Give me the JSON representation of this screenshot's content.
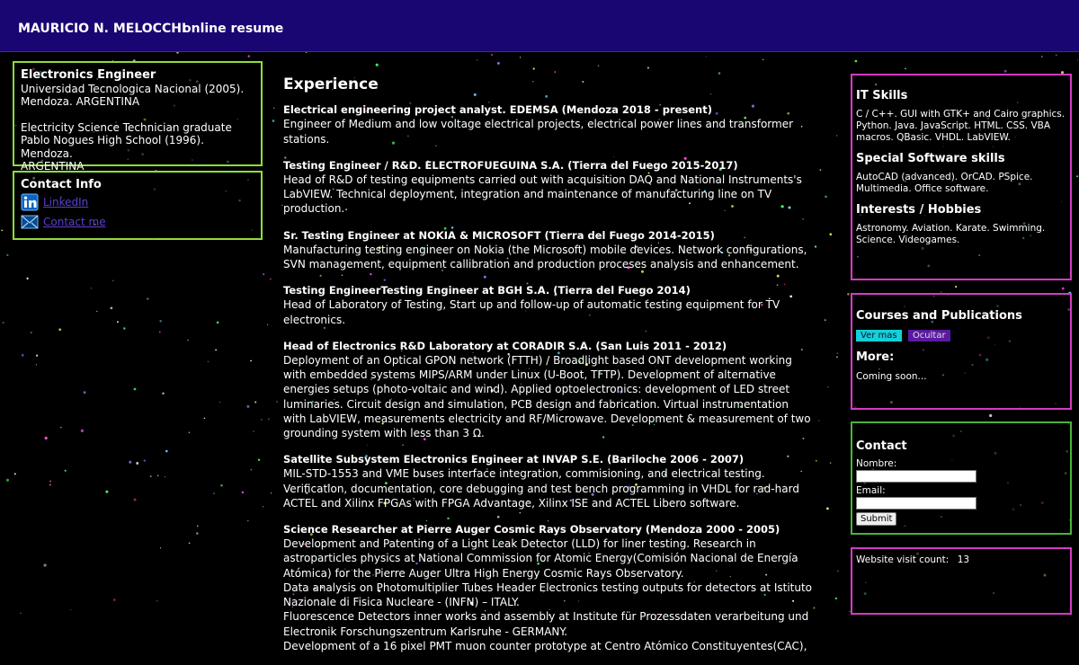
{
  "header": {
    "name": "MAURICIO N. MELOCCHI",
    "subtitle": "online resume"
  },
  "education": {
    "title": "Electronics Engineer",
    "line1": "Universidad Tecnologica Nacional (2005).",
    "line2": "Mendoza. ARGENTINA",
    "line3": "Electricity Science Technician graduate",
    "line4": "Pablo Nogues High School (1996). Mendoza.",
    "line5": "ARGENTINA"
  },
  "contact_info": {
    "title": "Contact Info",
    "linkedin_label": "LinkedIn",
    "mail_label": "Contact me",
    "icons": [
      "linkedin-icon",
      "mail-icon"
    ]
  },
  "experience": {
    "heading": "Experience",
    "jobs": [
      {
        "title": "Electrical engineering project analyst. EDEMSA (Mendoza 2018 - present)",
        "desc": "Engineer of Medium and low voltage electrical projects, electrical power lines and transformer stations."
      },
      {
        "title": "Testing Engineer / R&D. ELECTROFUEGUINA S.A. (Tierra del Fuego 2015-2017)",
        "desc": "Head of R&D of testing equipments carried out with acquisition DAQ and National Instruments's LabVIEW. Technical deployment, integration and maintenance of manufacturing line on TV production."
      },
      {
        "title": "Sr. Testing Engineer at NOKIA & MICROSOFT (Tierra del Fuego 2014-2015)",
        "desc": "Manufacturing testing engineer on Nokia (the Microsoft) mobile devices. Network configurations, SVN management, equipment callibration and production proceses analysis and enhancement."
      },
      {
        "title": "Testing EngineerTesting Engineer at BGH S.A. (Tierra del Fuego 2014)",
        "desc": "Head of Laboratory of Testing, Start up and follow-up of automatic testing equipment for TV electronics."
      },
      {
        "title": "Head of Electronics R&D Laboratory at CORADIR S.A. (San Luis 2011 - 2012)",
        "desc": "Deployment of an Optical GPON network (FTTH) / Broadlight based ONT development working with embedded systems MIPS/ARM under Linux (U-Boot, TFTP). Development of alternative energies setups (photo-voltaic and wind). Applied optoelectronics: development of LED street luminaries. Circuit design and simulation, PCB design and fabrication. Virtual instrumentation with LabVIEW, measurements electricity and RF/Microwave. Development & measurement of two grounding system with less than 3 Ω."
      },
      {
        "title": "Satellite Subsystem Electronics Engineer at INVAP S.E. (Bariloche 2006 - 2007)",
        "desc": "MIL-STD-1553 and VME buses interface integration, commisioning, and electrical testing. Verification, documentation, core debugging and test bench programming in VHDL for rad-hard ACTEL and Xilinx FPGAs with FPGA Advantage, Xilinx ISE and ACTEL Libero software."
      },
      {
        "title": "Science Researcher at Pierre Auger Cosmic Rays Observatory (Mendoza 2000 - 2005)",
        "desc": "Development and Patenting of a Light Leak Detector (LLD) for liner testing. Research in astroparticles physics at National Commission for Atomic Energy(Comisión Nacional de Energía Atómica) for the Pierre Auger Ultra High Energy Cosmic Rays Observatory.",
        "desc2": "Data analysis on Photomultiplier Tubes Header Electronics testing outputs for detectors at Istituto Nazionale di Fisica Nucleare - (INFN) – ITALY.",
        "desc3": "Fluorescence Detectors inner works and assembly at Institute für Prozessdaten verarbeitung und Electronik Forschungszentrum Karlsruhe - GERMANY.",
        "desc4": "Development of a 16 pixel PMT muon counter prototype at Centro Atómico Constituyentes(CAC),"
      }
    ]
  },
  "skills": {
    "it_title": "IT Skills",
    "it_text": "C / C++. GUI with GTK+ and Cairo graphics. Python. Java. JavaScript. HTML. CSS. VBA macros. QBasic. VHDL. LabVIEW.",
    "sw_title": "Special Software skills",
    "sw_text": "AutoCAD (advanced). OrCAD. PSpice. Multimedia. Office software.",
    "int_title": "Interests / Hobbies",
    "int_text": "Astronomy. Aviation. Karate. Swimming. Science. Videogames."
  },
  "courses": {
    "title": "Courses and Publications",
    "show_label": "Ver mas",
    "hide_label": "Ocultar",
    "more_title": "More:",
    "more_text": "Coming soon..."
  },
  "contact_form": {
    "title": "Contact",
    "name_label": "Nombre:",
    "email_label": "Email:",
    "submit_label": "Submit"
  },
  "visits": {
    "label": "Website visit count:",
    "count": "13"
  }
}
